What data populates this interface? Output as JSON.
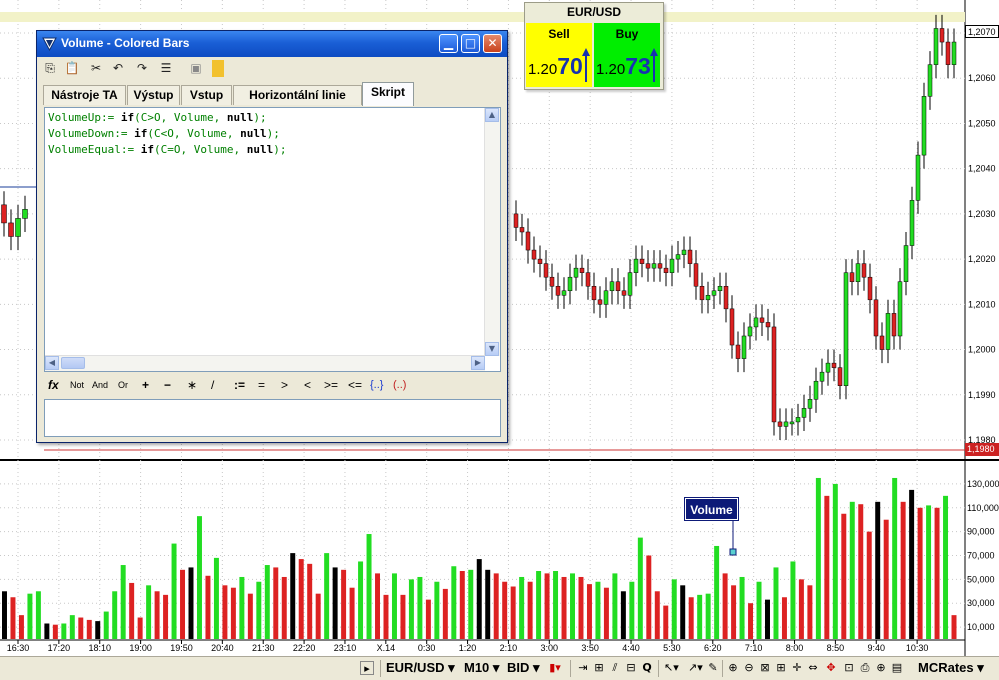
{
  "window": {
    "title": "Volume - Colored Bars",
    "toolbar_icons": [
      "copy-icon",
      "paste-icon",
      "cut-icon",
      "undo-icon",
      "redo-icon",
      "properties-icon",
      "save-icon",
      "exit-icon"
    ],
    "tabs": [
      "Nástroje TA",
      "Výstup",
      "Vstup",
      "Horizontální linie",
      "Skript"
    ],
    "active_tab": "Skript",
    "script": [
      {
        "var": "VolumeUp",
        "kw": "if",
        "args": "(C>O, Volume, ",
        "null": "null",
        "end": ");"
      },
      {
        "var": "VolumeDown",
        "kw": "if",
        "args": "(C<O, Volume, ",
        "null": "null",
        "end": ");"
      },
      {
        "var": "VolumeEqual",
        "kw": "if",
        "args": "(C=O, Volume, ",
        "null": "null",
        "end": ");"
      }
    ],
    "operators": {
      "fx": "fx",
      "not": "Not",
      "and": "And",
      "or": "Or",
      "plus": "+",
      "minus": "−",
      "mul": "∗",
      "div": "/",
      "assign": ":=",
      "eq": "=",
      "gt": ">",
      "lt": "<",
      "ge": ">=",
      "le": "<=",
      "brace": "{..}",
      "paren": "(..)"
    }
  },
  "quote": {
    "symbol": "EUR/USD",
    "sell": {
      "label": "Sell",
      "price_prefix": "1.20",
      "price_big": "70"
    },
    "buy": {
      "label": "Buy",
      "price_prefix": "1.20",
      "price_big": "73"
    }
  },
  "colors": {
    "up": "#22dd22",
    "down": "#dd2222",
    "equal": "#000000",
    "sell_bg": "#ffff00",
    "buy_bg": "#00ee00",
    "grid": "#c8c8c8",
    "level_line": "#cc3333"
  },
  "price_axis": {
    "labels": [
      "1,2070",
      "1,2060",
      "1,2050",
      "1,2040",
      "1,2030",
      "1,2020",
      "1,2010",
      "1,2000",
      "1,1990",
      "1,1980"
    ],
    "current_label": "1,2070",
    "low_label": "1,1980",
    "range": [
      1.198,
      1.207
    ]
  },
  "volume_axis": {
    "labels": [
      "130,000",
      "110,000",
      "90,000",
      "70,000",
      "50,000",
      "30,000",
      "10,000"
    ],
    "range": [
      0,
      140000
    ]
  },
  "volume_label": "Volume",
  "time_labels": [
    "16:30",
    "17:20",
    "18:10",
    "19:00",
    "19:50",
    "20:40",
    "21:30",
    "22:20",
    "23:10",
    "X.14",
    "0:30",
    "1:20",
    "2:10",
    "3:00",
    "3:50",
    "4:40",
    "5:30",
    "6:20",
    "7:10",
    "8:00",
    "8:50",
    "9:40",
    "10:30"
  ],
  "statusbar": {
    "symbol": "EUR/USD",
    "timeframe": "M10",
    "price_type": "BID",
    "brand": "MCRates"
  },
  "chart_data": {
    "type": "bar",
    "series": [
      {
        "name": "Volume",
        "values": [
          40000,
          35000,
          20000,
          38000,
          40000,
          13000,
          12000,
          13000,
          20000,
          18000,
          16000,
          15000,
          23000,
          40000,
          62000,
          47000,
          18000,
          45000,
          40000,
          37000,
          80000,
          58000,
          60000,
          103000,
          53000,
          68000,
          45000,
          43000,
          52000,
          38000,
          48000,
          62000,
          60000,
          52000,
          72000,
          67000,
          63000,
          38000,
          72000,
          60000,
          58000,
          43000,
          65000,
          88000,
          55000,
          37000,
          55000,
          37000,
          50000,
          52000,
          33000,
          48000,
          42000,
          61000,
          57000,
          58000,
          67000,
          58000,
          55000,
          48000,
          44000,
          52000,
          48000,
          57000,
          55000,
          57000,
          52000,
          55000,
          52000,
          46000,
          48000,
          43000,
          55000,
          40000,
          48000,
          85000,
          70000,
          40000,
          28000,
          50000,
          45000,
          35000,
          37000,
          38000,
          78000,
          55000,
          45000,
          52000,
          30000,
          48000,
          33000,
          60000,
          35000,
          65000,
          50000,
          45000,
          135000,
          120000,
          130000,
          105000,
          115000,
          113000,
          90000,
          115000,
          100000,
          135000,
          115000,
          125000,
          110000,
          112000,
          110000,
          120000,
          20000
        ]
      },
      {
        "name": "Price",
        "values": [
          1.2028,
          1.2025,
          1.2029,
          1.2031,
          1.2027,
          1.2026,
          1.2022,
          1.202,
          1.2019,
          1.2016,
          1.2014,
          1.2012,
          1.2013,
          1.2016,
          1.2018,
          1.2017,
          1.2014,
          1.2011,
          1.201,
          1.2013,
          1.2015,
          1.2013,
          1.2012,
          1.2017,
          1.202,
          1.2019,
          1.2018,
          1.2019,
          1.2018,
          1.2017,
          1.202,
          1.2021,
          1.2022,
          1.2019,
          1.2014,
          1.2011,
          1.2012,
          1.2013,
          1.2014,
          1.2009,
          1.2001,
          1.1998,
          1.2003,
          1.2005,
          1.2007,
          1.2006,
          1.2005,
          1.1984,
          1.1983,
          1.1984,
          1.1984,
          1.1985,
          1.1987,
          1.1989,
          1.1993,
          1.1995,
          1.1997,
          1.1996,
          1.1992,
          1.2017,
          1.2015,
          1.2019,
          1.2016,
          1.2011,
          1.2003,
          1.2,
          1.2008,
          1.2003,
          1.2015,
          1.2023,
          1.2033,
          1.2043,
          1.2056,
          1.2063,
          1.2071,
          1.2068,
          1.2063,
          1.2068
        ]
      }
    ],
    "ylabel_volume": "",
    "grid": true
  }
}
